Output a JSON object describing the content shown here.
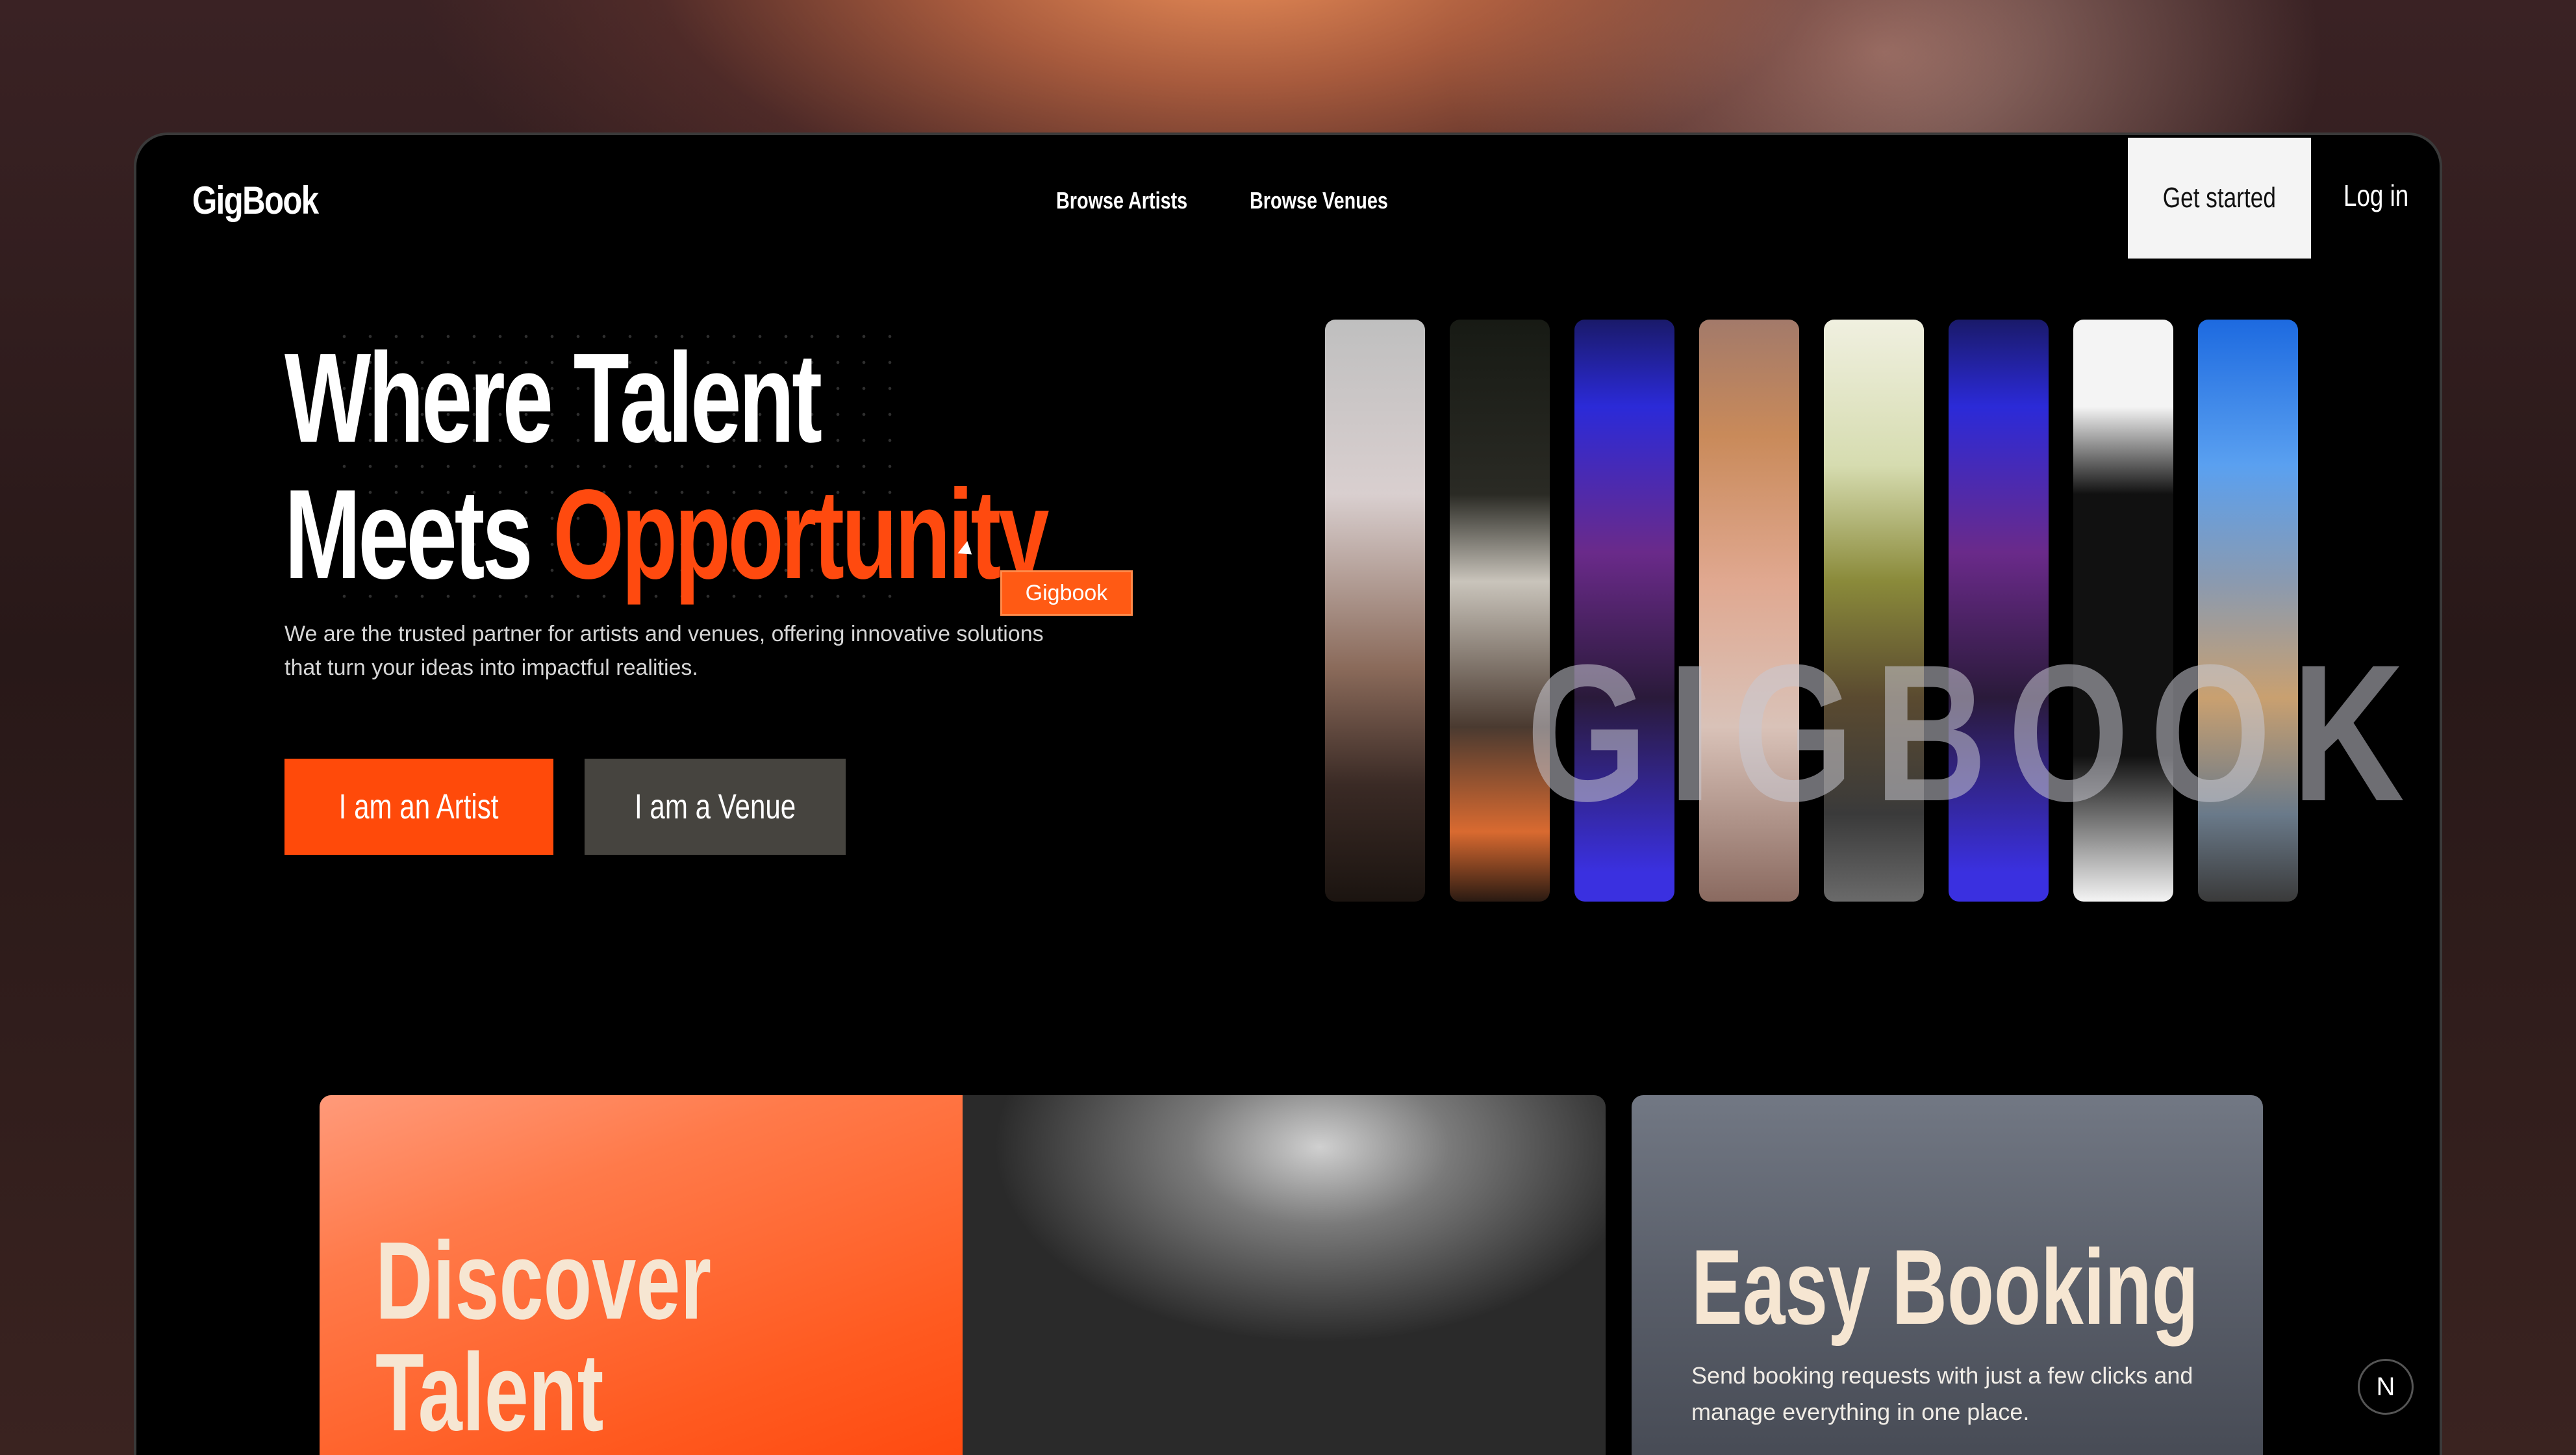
{
  "header": {
    "logo": "GigBook",
    "nav": [
      "Browse Artists",
      "Browse Venues"
    ],
    "get_started": "Get started",
    "login": "Log in"
  },
  "hero": {
    "title_line1": "Where Talent",
    "title_line2_prefix": "Meets ",
    "title_line2_accent": "Opportunity",
    "tag": "Gigbook",
    "description": "We are the trusted partner for artists and venues, offering innovative solutions that turn your ideas into impactful realities.",
    "artist_button": "I am an Artist",
    "venue_button": "I am a Venue",
    "ghost_text": "GIGBOOK"
  },
  "cards": {
    "discover_title_1": "Discover",
    "discover_title_2": "Talent",
    "booking_title": "Easy Booking",
    "booking_desc": "Send booking requests with just a few clicks and manage everything in one place."
  },
  "badge": "N",
  "colors": {
    "accent": "#ff4a0f",
    "venue_button": "#46443f",
    "card_text": "#f6e6d2"
  }
}
